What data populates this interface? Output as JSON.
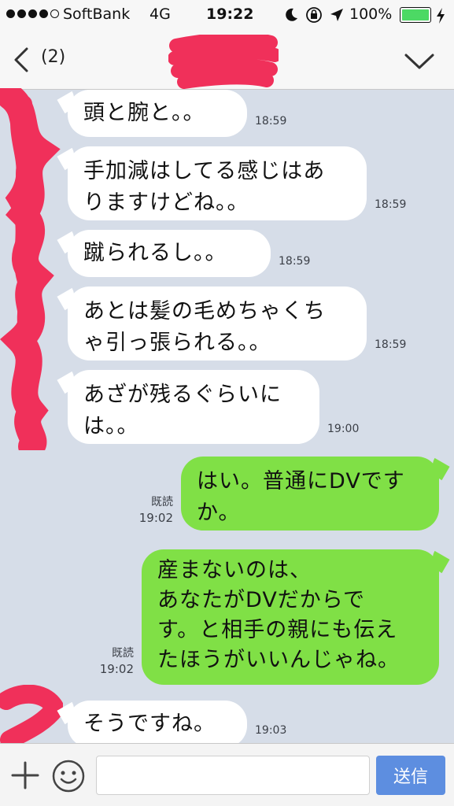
{
  "status_bar": {
    "carrier": "SoftBank",
    "network": "4G",
    "time": "19:22",
    "battery": "100%",
    "battery_level": 1.0,
    "battery_color": "#4cd964"
  },
  "header": {
    "member_count": "(2)",
    "back_icon": "chevron-left-icon",
    "menu_icon": "chevron-down-icon"
  },
  "messages": [
    {
      "side": "in",
      "text": "頭と腕と。。",
      "time": "18:59"
    },
    {
      "side": "in",
      "text": "手加減はしてる感じはあ\nりますけどね。。",
      "time": "18:59"
    },
    {
      "side": "in",
      "text": "蹴られるし。。",
      "time": "18:59"
    },
    {
      "side": "in",
      "text": "あとは髪の毛めちゃくち\nゃ引っ張られる。。",
      "time": "18:59"
    },
    {
      "side": "in",
      "text": "あざが残るぐらいに\nは。。",
      "time": "19:00"
    },
    {
      "side": "out",
      "text": "はい。普通にDVです\nか。",
      "time": "19:02",
      "read": "既読"
    },
    {
      "side": "out",
      "text": "産まないのは、\nあなたがDVだからで\nす。と相手の親にも伝え\nたほうがいいんじゃね。",
      "time": "19:02",
      "read": "既読"
    },
    {
      "side": "in",
      "text": "そうですね。",
      "time": "19:03"
    }
  ],
  "composer": {
    "placeholder": "",
    "send_label": "送信",
    "plus_icon": "plus-icon",
    "emoji_icon": "smiley-icon"
  },
  "colors": {
    "chat_bg": "#d6dde8",
    "outgoing_bubble": "#80e046",
    "incoming_bubble": "#ffffff",
    "send_button": "#5d8ee0",
    "redaction": "#f0305a"
  }
}
